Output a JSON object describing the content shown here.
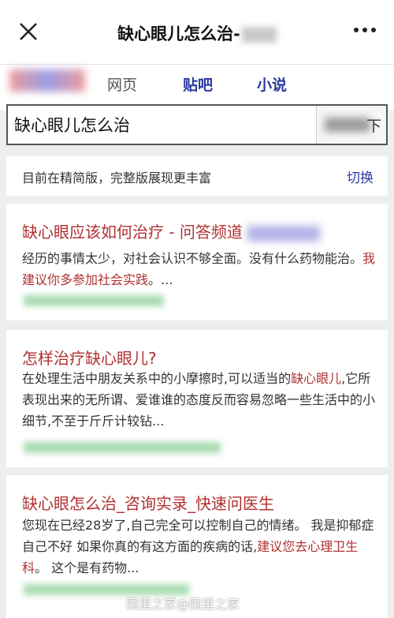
{
  "header": {
    "title": "缺心眼儿怎么治-",
    "close_icon": "close-icon",
    "more_icon": "more-icon"
  },
  "nav": {
    "tabs": [
      "网页",
      "贴吧",
      "小说"
    ]
  },
  "search": {
    "value": "缺心眼儿怎么治",
    "button_char": "下"
  },
  "notice": {
    "text": "目前在精简版，完整版展现更丰富",
    "link": "切换"
  },
  "results": [
    {
      "title": "缺心眼应该如何治疗 - 问答频道",
      "snippet_plain": "经历的事情太少，对社会认识不够全面。没有什么药物能治。",
      "snippet_hl": "我建议你多参加社会实践",
      "snippet_end": "。..."
    },
    {
      "title": "怎样治疗缺心眼儿?",
      "snippet_a": "在处理生活中朋友关系中的小摩擦时,可以适当的",
      "snippet_hl": "缺心眼儿",
      "snippet_b": ",它所表现出来的无所谓、爱谁谁的态度反而容易忽略一些生活中的小细节,不至于斤斤计较钻..."
    },
    {
      "title": "缺心眼怎么治_咨询实录_快速问医生",
      "snippet_a": "您现在已经28岁了,自己完全可以控制自己的情绪。 我是抑郁症 自己不好 如果你真的有这方面的疾病的话,",
      "snippet_hl": "建议您去心理卫生科",
      "snippet_b": "。 这个是有药物..."
    }
  ],
  "watermark": "围里之家@围里之家"
}
